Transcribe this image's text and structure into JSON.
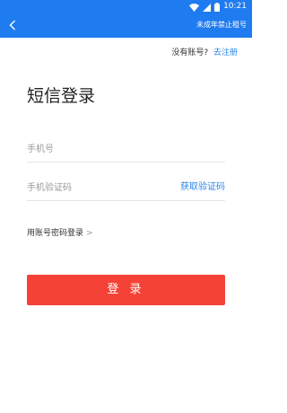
{
  "status_bar": {
    "time": "10:21",
    "icons": [
      "wifi-icon",
      "signal-icon",
      "battery-icon"
    ],
    "background": "#1f7bf0"
  },
  "app_bar": {
    "back_icon": "back-chevron-icon",
    "right_label": "未成年禁止租号",
    "background": "#1f7bf0"
  },
  "register": {
    "question": "没有账号?",
    "link_label": "去注册"
  },
  "title": "短信登录",
  "form": {
    "phone_placeholder": "手机号",
    "code_placeholder": "手机验证码",
    "get_code_label": "获取验证码"
  },
  "password_login": {
    "label": "用账号密码登录",
    "chevron": ">"
  },
  "login_button": {
    "label": "登 录",
    "color": "#f44336"
  },
  "accent_color": "#2a86e8"
}
